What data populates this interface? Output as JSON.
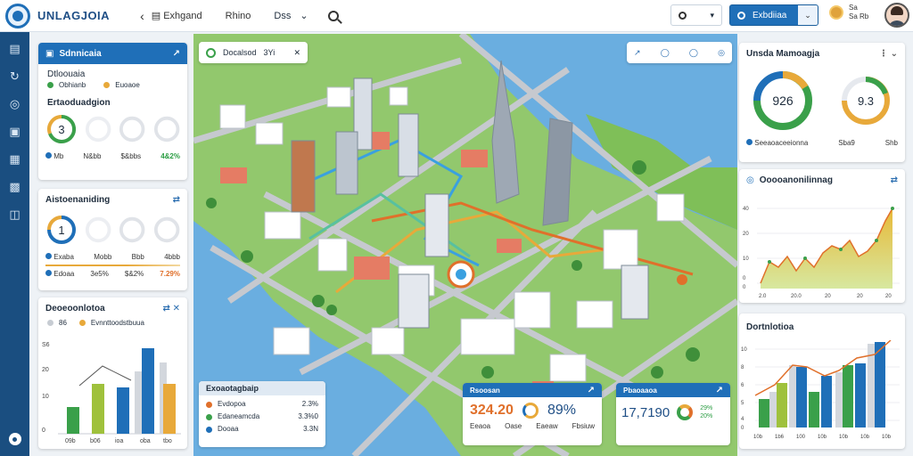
{
  "header": {
    "brand": "UNLAGJOIA",
    "links": [
      "Exhgand",
      "Rhino",
      "Dss"
    ],
    "filter_value": "",
    "dashboard_button": "Exbdiiaa",
    "user_line1": "Sa",
    "user_line2": "Sa Rb"
  },
  "sidebar": {
    "icons": [
      "panel-icon",
      "refresh-icon",
      "globe-icon",
      "chart-icon",
      "grid-icon",
      "report-icon",
      "layers-icon"
    ]
  },
  "left_panel_1": {
    "title": "Sdnnicaia",
    "subtitle": "Dtloouaia",
    "legend": [
      "Obhianb",
      "Euoaoe"
    ],
    "section": "Ertaoduadgion",
    "ring_value": "3",
    "stats": [
      "Mb",
      "N&bb",
      "$&bbs",
      "4&2%"
    ]
  },
  "left_panel_2": {
    "title": "Aistoenaniding",
    "ring_value": "1",
    "stats_a": [
      "Exaba",
      "Mobb",
      "Bbb",
      "4bbb"
    ],
    "stats_b": [
      "Edoaa",
      "3e5%",
      "$&2%",
      "7.29%"
    ]
  },
  "left_panel_3": {
    "title": "Deoeoonlotoa",
    "legend": [
      "86",
      "Evnnttoodstbuua"
    ],
    "y_ticks": [
      "S6",
      "20",
      "10",
      "0"
    ],
    "x_ticks": [
      "09b",
      "b06",
      "ioa",
      "oba",
      "tbo"
    ],
    "icon_label": "$ 3"
  },
  "map_chip": {
    "label": "Docalsod",
    "value": "3Yi"
  },
  "map_legend": {
    "title": "Exoaotagbaip",
    "rows": [
      {
        "label": "Evdopoa",
        "value": "2.3%"
      },
      {
        "label": "Edaneamcda",
        "value": "3.3%0"
      },
      {
        "label": "Dooaa",
        "value": "3.3N"
      }
    ]
  },
  "kpi_left": {
    "title": "Rsoosan",
    "value": "324.20",
    "percent": "89%",
    "labels": [
      "Eeaoa",
      "Oase",
      "Eaeaw",
      "Fbsiuw"
    ]
  },
  "kpi_right": {
    "title": "Pbaoaaoa",
    "value": "17,7190",
    "values": [
      "29%",
      "20%"
    ]
  },
  "right_panel_1": {
    "title": "Unsda Mamoagja",
    "ring1": "926",
    "ring2": "9.3",
    "legend": [
      "Seeaoaceeionna",
      "Sba9",
      "Shb"
    ]
  },
  "right_panel_2": {
    "title": "Ooooanonilinnag",
    "y_ticks": [
      "40",
      "20",
      "10",
      "0",
      "0"
    ],
    "x_ticks": [
      "2.0",
      "20.0",
      "20",
      "20",
      "20"
    ]
  },
  "right_panel_3": {
    "title": "Dortnlotioa",
    "y_ticks": [
      "10",
      "8",
      "6",
      "5",
      "4",
      "0"
    ],
    "x_ticks": [
      "10b",
      "1b6",
      "100",
      "10b",
      "10b",
      "10b",
      "10b"
    ]
  },
  "colors": {
    "brand_blue": "#1f6fb8",
    "sidebar": "#1a4e80",
    "green": "#3aa04a",
    "amber": "#e8a93a",
    "orange": "#e0702b",
    "water": "#6aaee0"
  }
}
